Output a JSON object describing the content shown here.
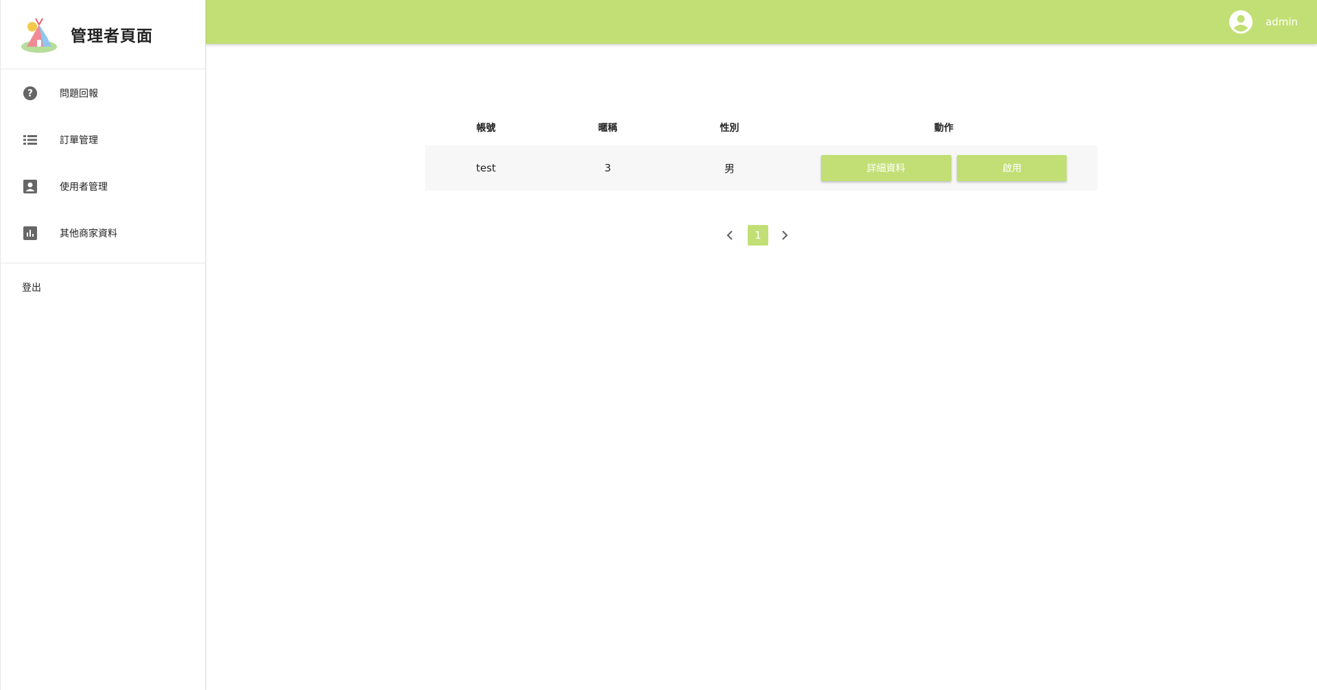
{
  "app": {
    "title": "管理者頁面"
  },
  "sidebar": {
    "items": [
      {
        "label": "問題回報",
        "icon": "help-circle-icon"
      },
      {
        "label": "訂單管理",
        "icon": "list-icon"
      },
      {
        "label": "使用者管理",
        "icon": "account-box-icon"
      },
      {
        "label": "其他商家資料",
        "icon": "bar-chart-icon"
      }
    ],
    "logout_label": "登出"
  },
  "header": {
    "username": "admin",
    "avatar_icon": "account-circle-icon"
  },
  "table": {
    "columns": [
      "帳號",
      "暱稱",
      "性別",
      "動作"
    ],
    "rows": [
      {
        "account": "test",
        "nickname": "3",
        "gender": "男",
        "detail_label": "詳細資料",
        "enable_label": "啟用"
      }
    ]
  },
  "pagination": {
    "current_page": "1"
  },
  "colors": {
    "accent": "#c2df75",
    "row_bg": "#f7f7f7",
    "icon_gray": "#666666"
  }
}
